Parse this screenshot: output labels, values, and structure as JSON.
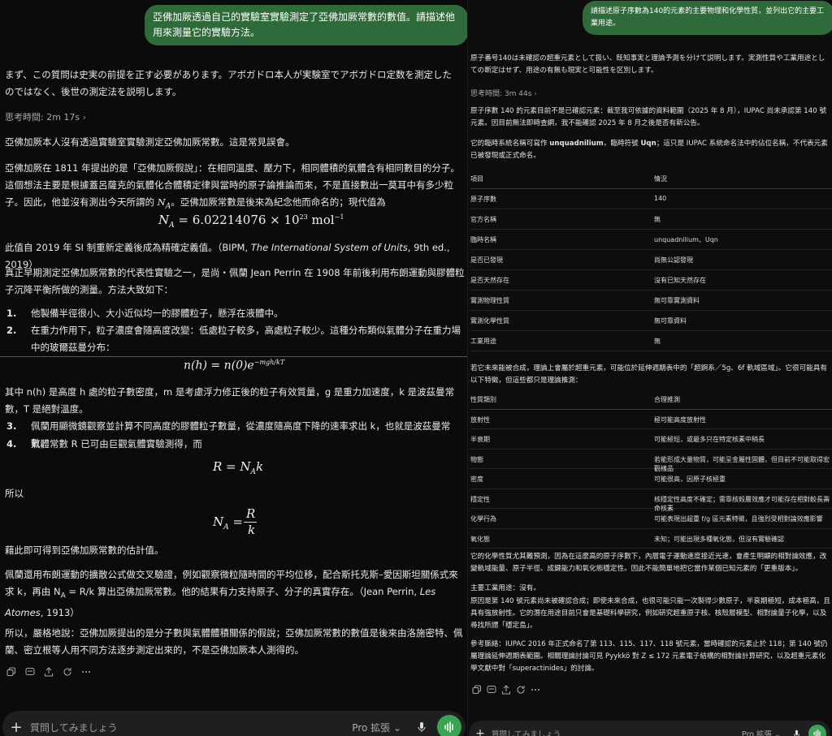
{
  "left": {
    "user_prompt": "亞佛加厥透過自己的實驗室實驗測定了亞佛加厥常數的數值。請描述他用來測量它的實驗方法。",
    "intro": "まず、この質問は史実の前提を正す必要があります。アボガドロ本人が実験室でアボガドロ定数を測定したのではなく、後世の測定法を説明します。",
    "thinking_time": "思考時間: 2m 17s",
    "p1": "亞佛加厥本人沒有透過實驗室實驗測定亞佛加厥常數。這是常見誤會。",
    "p2_a": "亞佛加厥在 1811 年提出的是「亞佛加厥假說」：在相同溫度、壓力下，相同體積的氣體含有相同數目的分子。這個想法主要是根據蓋呂薩克的氣體化合體積定律與當時的原子論推論而來，不是直接數出一莫耳中有多少粒子。因此，他並沒有測出今天所謂的",
    "p2_b": "。亞佛加厥常數是後來為紀念他而命名的；現代值為",
    "na_symbol": "N",
    "na_sub": "A",
    "eq1_lhs": "N",
    "eq1_sub": "A",
    "eq1_rhs": "= 6.02214076 × 10",
    "eq1_exp": "23",
    "eq1_unit": " mol",
    "eq1_unit_exp": "−1",
    "p3_a": "此值自 2019 年 SI 制重新定義後成為精確定義值。（BIPM, ",
    "p3_ital": "The International System of Units",
    "p3_b": ", 9th ed., 2019）",
    "p4": "真正早期測定亞佛加厥常數的代表性實驗之一，是尚・佩蘭 Jean Perrin 在 1908 年前後利用布朗運動與膠體粒子沉降平衡所做的測量。方法大致如下：",
    "list1": "他製備半徑很小、大小近似均一的膠體粒子，懸浮在液體中。",
    "list2": "在重力作用下，粒子濃度會隨高度改變：低處粒子較多，高處粒子較少。這種分布類似氣體分子在重力場中的玻爾茲曼分布：",
    "eq2": "n(h) = n(0)e",
    "eq2_exp": "−mgh/kT",
    "p5": "其中 n(h) 是高度 h 處的粒子數密度，m 是考慮浮力修正後的粒子有效質量，g 是重力加速度，k 是波茲曼常數，T 是絕對溫度。",
    "list3": "佩蘭用顯微鏡觀察並計算不同高度的膠體粒子數量，從濃度隨高度下降的速率求出 k，也就是波茲曼常數。",
    "list4": "氣體常數 R 已可由巨觀氣體實驗測得，而",
    "eq3": "R = N",
    "eq3_sub": "A",
    "eq3_k": "k",
    "so": "所以",
    "eq4_lhs": "N",
    "eq4_sub": "A",
    "eq4_num": "R",
    "eq4_den": "k",
    "p6": "藉此即可得到亞佛加厥常數的估計值。",
    "p7_a": "佩蘭還用布朗運動的擴散公式做交叉驗證，例如觀察微粒隨時間的平均位移，配合斯托克斯–愛因斯坦關係式來求 k，再由 N",
    "p7_b": " = R/k 算出亞佛加厥常數。他的結果有力支持原子、分子的真實存在。（Jean Perrin, ",
    "p7_ital": "Les Atomes",
    "p7_c": ", 1913）",
    "p8": "所以，嚴格地說：亞佛加厥提出的是分子數與氣體體積關係的假說；亞佛加厥常數的數值是後來由洛施密特、佩蘭、密立根等人用不同方法逐步測定出來的，不是亞佛加厥本人測得的。",
    "composer_placeholder": "質問してみましょう",
    "pro_label": "Pro 拡張 ⌄"
  },
  "right": {
    "user_prompt": "請描述原子序數為140的元素的主要物理和化學性質，並列出它的主要工業用途。",
    "intro": "原子番号140は未確認の超重元素として扱い、既知事実と理論予測を分けて説明します。実測性質や工業用途としての断定はせず、用途の有無も現実と可能性を区別します。",
    "thinking_time": "思考時間: 3m 44s",
    "p1": "原子序數 140 的元素目前不是已確認元素：截至我可依據的資料範圍（2025 年 8 月），IUPAC 尚未承認第 140 號元素。因目前無法即時查網，我不能確認 2025 年 8 月之後是否有新公告。",
    "p2_a": "它的臨時系統名稱可寫作 ",
    "p2_b1": "unquadnilium",
    "p2_c": "，臨時符號 ",
    "p2_b2": "Uqn",
    "p2_d": "；這只是 IUPAC 系統命名法中的佔位名稱，不代表元素已被發現或正式命名。",
    "t1_headers": [
      "項目",
      "情況"
    ],
    "t1_rows": [
      [
        "原子序數",
        "140"
      ],
      [
        "官方名稱",
        "無"
      ],
      [
        "臨時名稱",
        "unquadnilium、Uqn"
      ],
      [
        "是否已發現",
        "尚無公認發現"
      ],
      [
        "是否天然存在",
        "沒有已知天然存在"
      ],
      [
        "實測物理性質",
        "無可靠實測資料"
      ],
      [
        "實測化學性質",
        "無可靠資料"
      ],
      [
        "工業用途",
        "無"
      ]
    ],
    "p3": "若它未來能被合成，理論上會屬於超重元素，可能位於延伸週期表中的「超錒系／5g、6f 軌域區域」。它很可能具有以下特徵，但這些都只是理論推測：",
    "t2_headers": [
      "性質類別",
      "合理推測"
    ],
    "t2_rows": [
      [
        "放射性",
        "極可能高度放射性"
      ],
      [
        "半衰期",
        "可能極短，或最多只在特定核素中稍長"
      ],
      [
        "物態",
        "若能形成大量物質，可能呈金屬性固體，但目前不可能取得宏觀樣品"
      ],
      [
        "密度",
        "可能很高，因原子核極重"
      ],
      [
        "穩定性",
        "核穩定性高度不確定；需靠核殼層效應才可能存在相對較長壽命核素"
      ],
      [
        "化學行為",
        "可能表現出超重 f/g 區元素特徵，且強烈受相對論效應影響"
      ],
      [
        "氧化態",
        "未知；可能出現多種氧化態，但沒有實驗確認"
      ]
    ],
    "p4": "它的化學性質尤其難預測，因為在這麼高的原子序數下，內層電子運動速度接近光速，會產生明顯的相對論效應，改變軌域能量、原子半徑、成鍵能力和氧化態穩定性。因此不能簡單地把它當作某個已知元素的「更重版本」。",
    "p5": "主要工業用途：沒有。",
    "p6": "原因是第 140 號元素尚未被確認合成；即使未來合成，也很可能只能一次製得少數原子，半衰期極短，成本極高，且具有強放射性。它的潛在用途目前只會是基礎科學研究，例如研究超重原子核、核殼層模型、相對論量子化學，以及尋找所謂「穩定島」。",
    "p7": "參考脈絡：IUPAC 2016 年正式命名了第 113、115、117、118 號元素，當時確認的元素止於 118；第 140 號仍屬理論延伸週期表範圍。相關理論討論可見 Pyykkö 對 Z ≤ 172 元素電子結構的相對論計算研究，以及超重元素化學文獻中對「superactinides」的討論。",
    "composer_placeholder": "質問してみましょう",
    "pro_label": "Pro 拡張 ⌄"
  },
  "colors": {
    "bubble_green": "#2f6a3a",
    "voice_green": "#3aa454",
    "background": "#0b0b0b"
  },
  "icons": [
    "copy-icon",
    "comment-icon",
    "share-icon",
    "refresh-icon",
    "more-icon",
    "plus-icon",
    "chevron-right-icon",
    "mic-icon",
    "voice-icon"
  ]
}
